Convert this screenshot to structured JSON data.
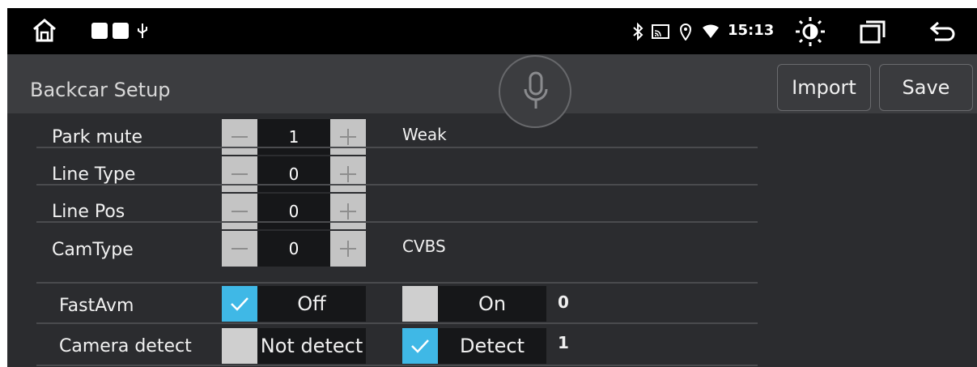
{
  "status_bar": {
    "icons": [
      "home-icon",
      "notification-square-icon",
      "notification-square-icon",
      "usb-icon",
      "bluetooth-icon",
      "cast-icon",
      "location-icon",
      "wifi-icon",
      "brightness-icon",
      "recent-apps-icon",
      "back-icon"
    ],
    "time": "15:13"
  },
  "header": {
    "title": "Backcar Setup",
    "import_label": "Import",
    "save_label": "Save",
    "mic_icon": "microphone-icon"
  },
  "rows": [
    {
      "label": "Park mute",
      "value": "1",
      "info": "Weak"
    },
    {
      "label": "Line Type",
      "value": "0",
      "info": ""
    },
    {
      "label": "Line Pos",
      "value": "0",
      "info": ""
    },
    {
      "label": "CamType",
      "value": "0",
      "info": "CVBS"
    }
  ],
  "options": [
    {
      "label": "FastAvm",
      "option_a": "Off",
      "option_a_checked": true,
      "option_b": "On",
      "option_b_checked": false,
      "value": "0"
    },
    {
      "label": "Camera detect",
      "option_a": "Not detect",
      "option_a_checked": false,
      "option_b": "Detect",
      "option_b_checked": true,
      "value": "1"
    }
  ],
  "colors": {
    "accent": "#3fb8e6",
    "background": "#2b2c2f",
    "header": "#3c3d40"
  }
}
